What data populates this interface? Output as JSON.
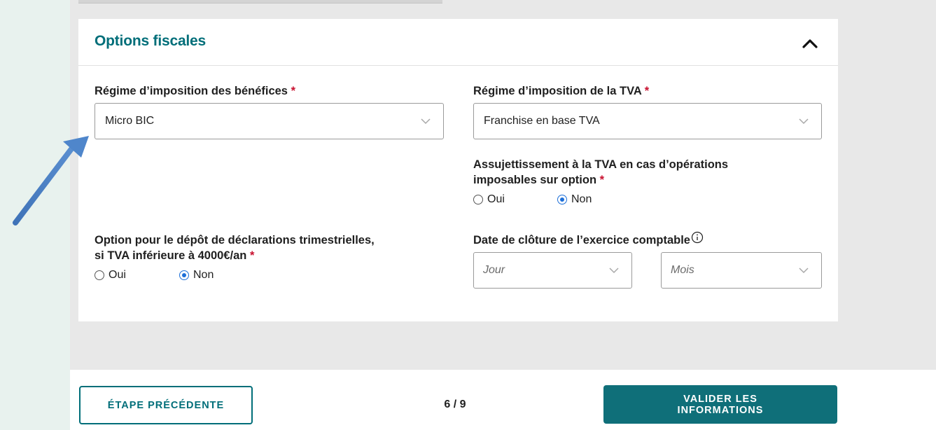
{
  "section": {
    "title": "Options fiscales"
  },
  "fields": {
    "regime_benefices": {
      "label": "Régime d’imposition des bénéfices",
      "required": "*",
      "value": "Micro BIC"
    },
    "regime_tva": {
      "label": "Régime d’imposition de la TVA",
      "required": "*",
      "value": "Franchise en base TVA"
    },
    "assujettissement": {
      "label_line1": "Assujettissement à la TVA en cas d’opérations",
      "label_line2": "imposables sur option",
      "required": "*",
      "options": [
        "Oui",
        "Non"
      ],
      "selected": "Non"
    },
    "depot_trimestriel": {
      "label_line1": "Option pour le dépôt de déclarations trimestrielles,",
      "label_line2": "si TVA inférieure à 4000€/an",
      "required": "*",
      "options": [
        "Oui",
        "Non"
      ],
      "selected": "Non"
    },
    "date_cloture": {
      "label": "Date de clôture de l’exercice comptable",
      "jour_placeholder": "Jour",
      "mois_placeholder": "Mois"
    }
  },
  "footer": {
    "prev_label": "ÉTAPE PRÉCÉDENTE",
    "page_indicator": "6 / 9",
    "next_label_line1": "VALIDER LES",
    "next_label_line2": "INFORMATIONS"
  },
  "colors": {
    "accent": "#006e79",
    "required": "#c8102e",
    "radio_selected": "#1d6fd8",
    "annotation_arrow": "#4a7fc4"
  },
  "icons": {
    "collapse": "chevron-up-icon",
    "dropdown": "chevron-down-icon",
    "info": "info-icon",
    "annotation": "arrow-annotation"
  }
}
